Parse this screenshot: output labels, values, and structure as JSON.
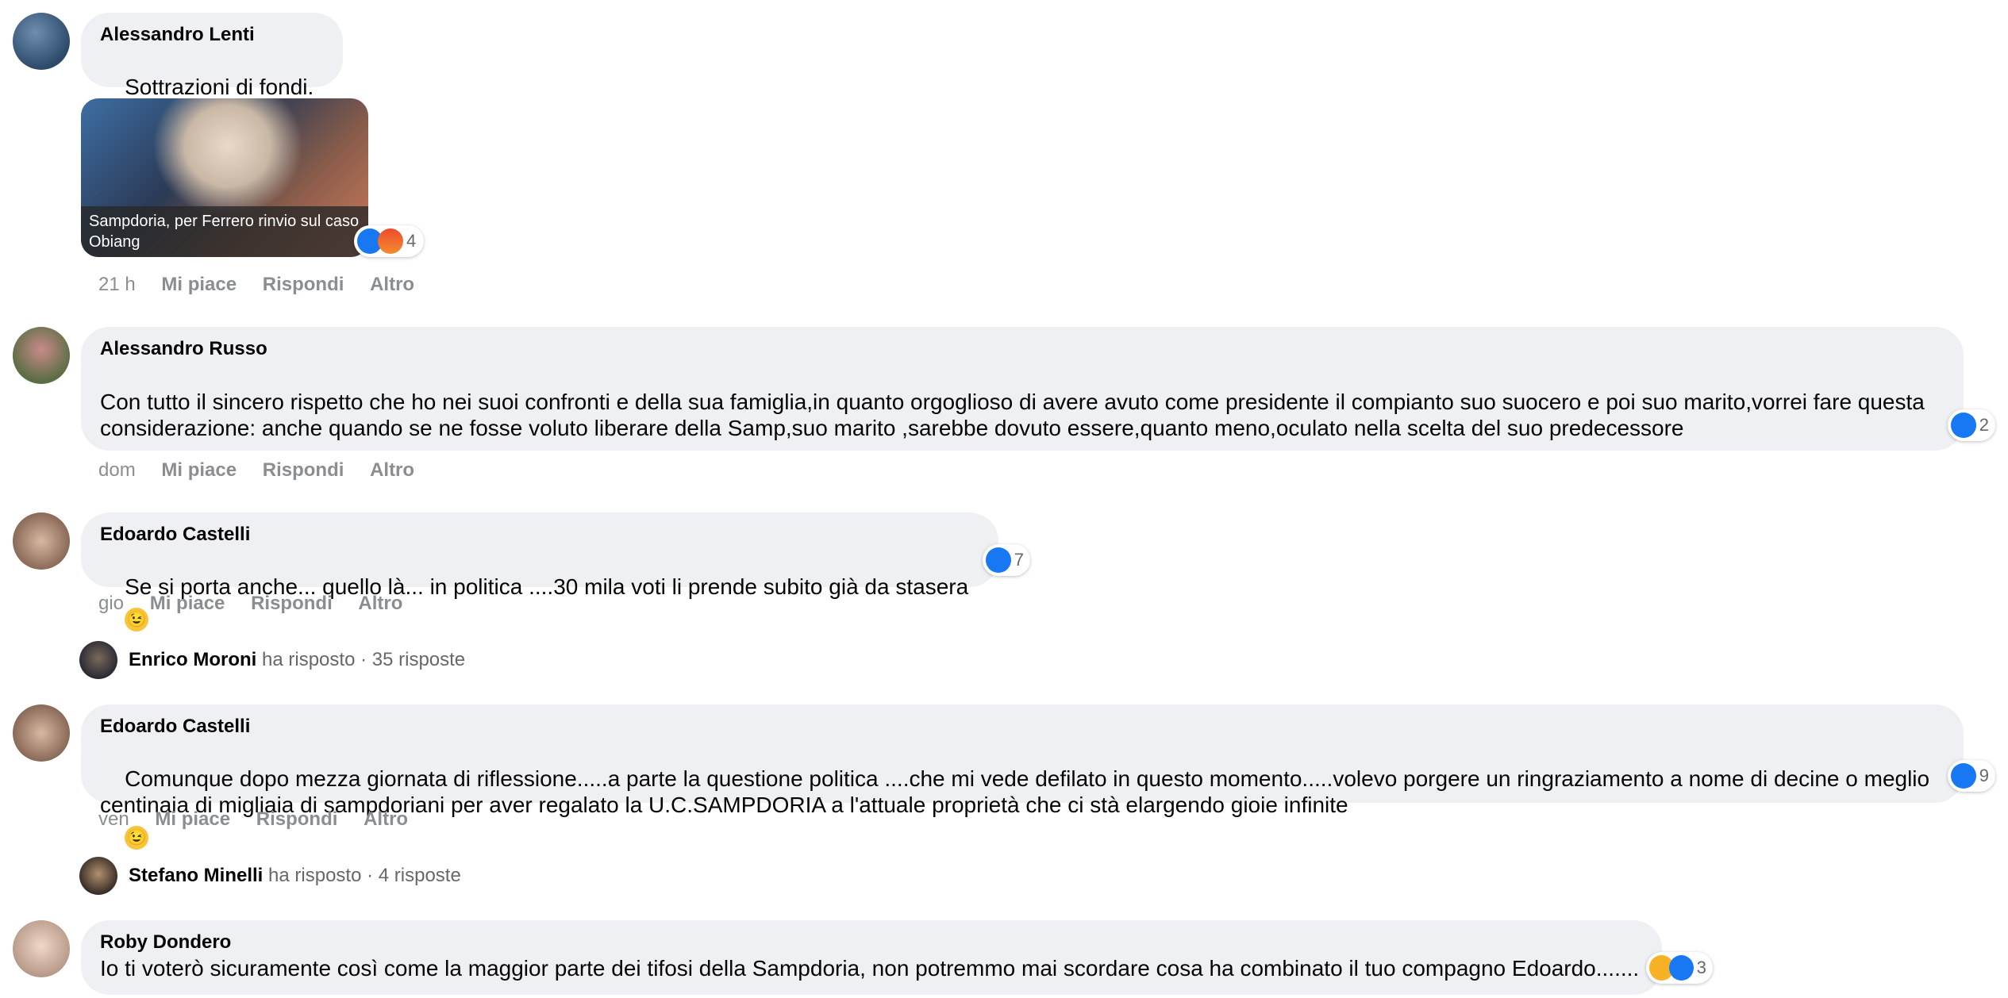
{
  "comments": [
    {
      "author": "Alessandro Lenti",
      "text": "Sottrazioni di fondi.",
      "link_title": "Sampdoria, per Ferrero rinvio sul caso Obiang",
      "reaction_count": "4",
      "time": "21 h"
    },
    {
      "author": "Alessandro Russo",
      "text": "Con tutto il sincero rispetto che ho nei suoi confronti e della sua famiglia,in quanto orgoglioso di avere avuto come presidente il compianto suo suocero e poi suo marito,vorrei fare questa considerazione: anche quando se ne fosse voluto liberare della Samp,suo marito ,sarebbe dovuto essere,quanto meno,oculato nella scelta del suo predecessore",
      "reaction_count": "2",
      "time": "dom"
    },
    {
      "author": "Edoardo Castelli",
      "text": "Se si porta anche... quello là... in politica ....30 mila voti li prende subito già da stasera",
      "reaction_count": "7",
      "time": "gio"
    },
    {
      "author": "Edoardo Castelli",
      "text": "Comunque dopo mezza giornata di riflessione.....a parte la questione politica ....che mi vede defilato in questo momento.....volevo porgere un ringraziamento a nome di decine o meglio centinaia di migliaia di sampdoriani per aver regalato la U.C.SAMPDORIA a l'attuale proprietà che ci stà elargendo gioie infinite",
      "reaction_count": "9",
      "time": "ven"
    },
    {
      "author": "Roby Dondero",
      "text": "Io ti voterò sicuramente così come la maggior parte dei tifosi della Sampdoria, non potremmo mai scordare cosa ha combinato il tuo compagno Edoardo.......",
      "reaction_count": "3"
    }
  ],
  "replies": [
    {
      "name": "Enrico Moroni",
      "verb": "ha risposto",
      "count": "· 35 risposte"
    },
    {
      "name": "Stefano Minelli",
      "verb": "ha risposto",
      "count": "· 4 risposte"
    }
  ],
  "actions": {
    "like": "Mi piace",
    "reply": "Rispondi",
    "more": "Altro"
  },
  "colors": {
    "bubble": "#eef0f3",
    "like_blue": "#1877f2",
    "meta_grey": "#8a8d91"
  },
  "icons": {
    "clap": "clapping-hands-icon",
    "wink": "winking-face-icon",
    "like": "like-icon",
    "angry": "angry-icon",
    "haha": "haha-icon"
  }
}
